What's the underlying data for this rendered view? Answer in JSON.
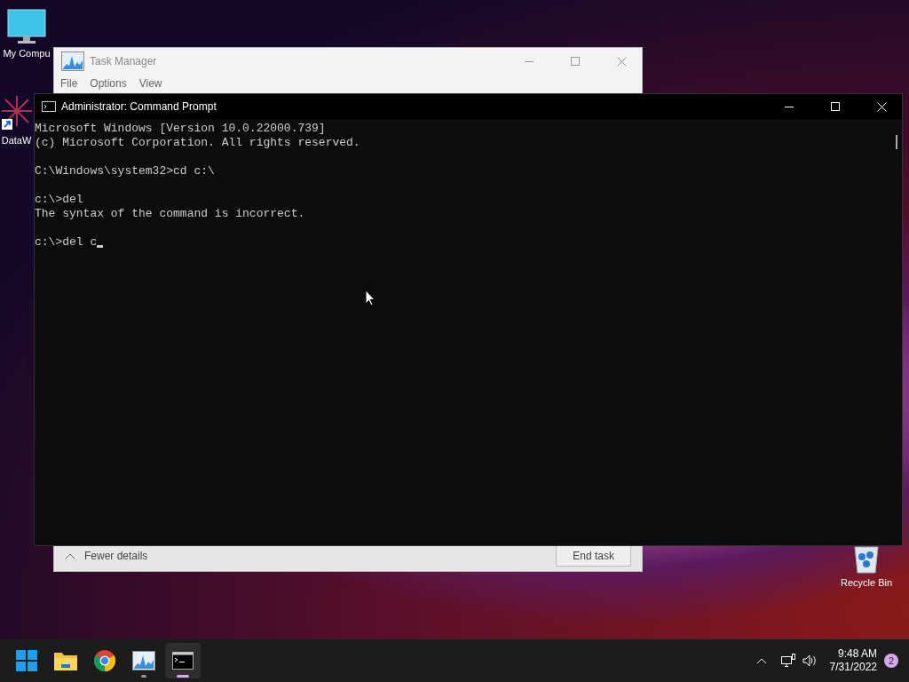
{
  "desktop_icons": [
    {
      "kind": "computer",
      "label": "My Compu"
    },
    {
      "kind": "shortcut",
      "label": "DataW"
    },
    {
      "kind": "recycle",
      "label": "Recycle Bin"
    }
  ],
  "task_manager": {
    "title": "Task Manager",
    "menu": [
      "File",
      "Options",
      "View"
    ],
    "fewer_details": "Fewer details",
    "end_task": "End task"
  },
  "command_prompt": {
    "title": "Administrator: Command Prompt",
    "blocks": [
      [
        "Microsoft Windows [Version 10.0.22000.739]",
        "(c) Microsoft Corporation. All rights reserved."
      ],
      [
        "C:\\Windows\\system32>cd c:\\"
      ],
      [
        "c:\\>del",
        "The syntax of the command is incorrect."
      ],
      [
        "c:\\>del c"
      ]
    ],
    "cursor": true
  },
  "taskbar": {
    "apps": [
      {
        "kind": "start",
        "running": false,
        "selected": false
      },
      {
        "kind": "explorer",
        "running": false,
        "selected": false
      },
      {
        "kind": "chrome",
        "running": false,
        "selected": false
      },
      {
        "kind": "taskmgr",
        "running": true,
        "selected": false
      },
      {
        "kind": "terminal",
        "running": true,
        "selected": true
      }
    ],
    "time": "9:48 AM",
    "date": "7/31/2022",
    "notifications": "2"
  }
}
